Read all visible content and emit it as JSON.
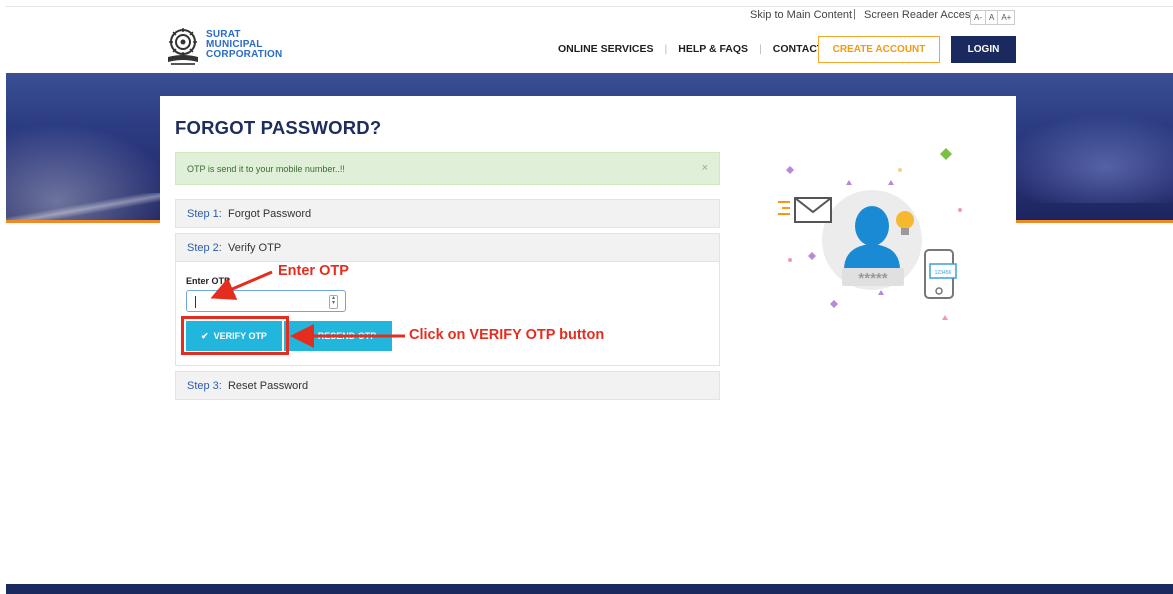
{
  "top_bar": {
    "skip_link": "Skip to Main Content",
    "separator": "|",
    "screen_reader": "Screen Reader Access",
    "font_sizes": [
      "A-",
      "A",
      "A+"
    ]
  },
  "header": {
    "logo_lines": [
      "SURAT",
      "MUNICIPAL",
      "CORPORATION"
    ],
    "nav": [
      "ONLINE SERVICES",
      "HELP & FAQS",
      "CONTACT"
    ],
    "nav_separator": "|",
    "create_account": "CREATE ACCOUNT",
    "login": "LOGIN"
  },
  "page": {
    "title": "FORGOT PASSWORD?",
    "alert_message": "OTP is send it to your mobile number..!!",
    "alert_close": "×",
    "steps": [
      {
        "prefix": "Step 1:",
        "label": "Forgot Password"
      },
      {
        "prefix": "Step 2:",
        "label": "Verify OTP"
      },
      {
        "prefix": "Step 3:",
        "label": "Reset Password"
      }
    ],
    "otp_label": "Enter OTP",
    "otp_value": "",
    "verify_button": "VERIFY OTP",
    "resend_button": "RESEND OTP"
  },
  "illustration": {
    "password_mask": "*****",
    "phone_code": "123456"
  },
  "annotations": {
    "enter_otp": "Enter OTP",
    "click_verify": "Click on VERIFY OTP button"
  },
  "colors": {
    "navy": "#1b2a5e",
    "accent_orange": "#f29a12",
    "button_blue": "#22b6dc",
    "annotation_red": "#e52d1f",
    "alert_green": "#e0efd7"
  }
}
